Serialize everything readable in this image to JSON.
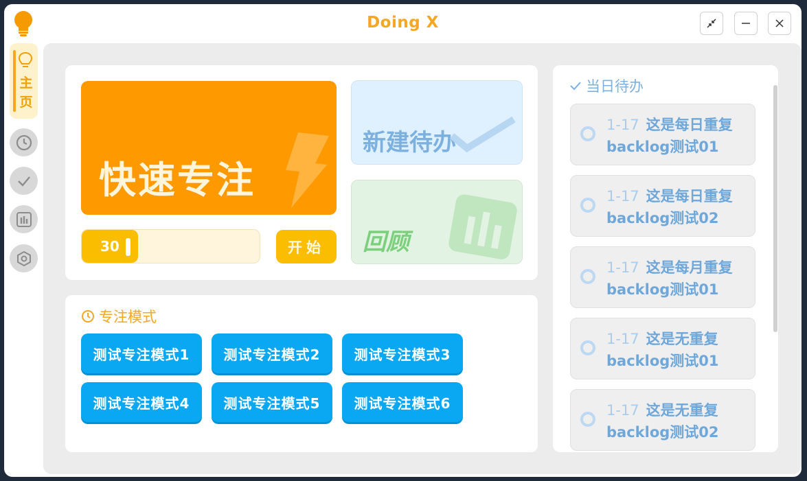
{
  "window": {
    "title": "Doing X",
    "accent_color": "#f5a623",
    "controls": [
      "collapse-icon",
      "minimize-icon",
      "close-icon"
    ]
  },
  "sidebar": {
    "home_label_1": "主",
    "home_label_2": "页",
    "items": [
      "bulb-icon",
      "clock-icon",
      "check-icon",
      "chart-icon",
      "settings-icon"
    ]
  },
  "quick_focus": {
    "label": "快速专注",
    "minutes": "30",
    "start_label": "开始",
    "color": "#fe9a00"
  },
  "new_todo": {
    "label": "新建待办"
  },
  "review": {
    "label": "回顾"
  },
  "focus_modes": {
    "title": "专注模式",
    "items": [
      "测试专注模式1",
      "测试专注模式2",
      "测试专注模式3",
      "测试专注模式4",
      "测试专注模式5",
      "测试专注模式6"
    ]
  },
  "daily_todo": {
    "title": "当日待办",
    "items": [
      {
        "date": "1-17",
        "text": "这是每日重复backlog测试01"
      },
      {
        "date": "1-17",
        "text": "这是每日重复backlog测试02"
      },
      {
        "date": "1-17",
        "text": "这是每月重复backlog测试01"
      },
      {
        "date": "1-17",
        "text": "这是无重复backlog测试01"
      },
      {
        "date": "1-17",
        "text": "这是无重复backlog测试02"
      }
    ]
  }
}
